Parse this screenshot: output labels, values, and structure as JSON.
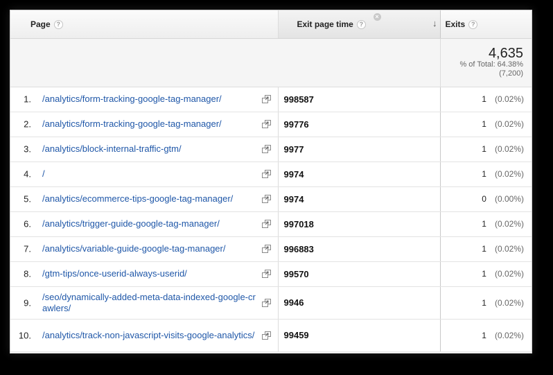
{
  "header": {
    "page_label": "Page",
    "time_label": "Exit page time",
    "exits_label": "Exits",
    "help_glyph": "?",
    "close_glyph": "×",
    "sort_glyph": "↓"
  },
  "summary": {
    "exits_total": "4,635",
    "exits_pct": "% of Total: 64.38%",
    "exits_site_total": "(7,200)"
  },
  "rows": [
    {
      "index": "1.",
      "page": "/analytics/form-tracking-google-tag-manager/",
      "time": "998587",
      "exits": "1",
      "pct": "(0.02%)"
    },
    {
      "index": "2.",
      "page": "/analytics/form-tracking-google-tag-manager/",
      "time": "99776",
      "exits": "1",
      "pct": "(0.02%)"
    },
    {
      "index": "3.",
      "page": "/analytics/block-internal-traffic-gtm/",
      "time": "9977",
      "exits": "1",
      "pct": "(0.02%)"
    },
    {
      "index": "4.",
      "page": "/",
      "time": "9974",
      "exits": "1",
      "pct": "(0.02%)"
    },
    {
      "index": "5.",
      "page": "/analytics/ecommerce-tips-google-tag-manager/",
      "time": "9974",
      "exits": "0",
      "pct": "(0.00%)"
    },
    {
      "index": "6.",
      "page": "/analytics/trigger-guide-google-tag-manager/",
      "time": "997018",
      "exits": "1",
      "pct": "(0.02%)"
    },
    {
      "index": "7.",
      "page": "/analytics/variable-guide-google-tag-manager/",
      "time": "996883",
      "exits": "1",
      "pct": "(0.02%)"
    },
    {
      "index": "8.",
      "page": "/gtm-tips/once-userid-always-userid/",
      "time": "99570",
      "exits": "1",
      "pct": "(0.02%)"
    },
    {
      "index": "9.",
      "page": "/seo/dynamically-added-meta-data-indexed-google-crawlers/",
      "time": "9946",
      "exits": "1",
      "pct": "(0.02%)"
    },
    {
      "index": "10.",
      "page": "/analytics/track-non-javascript-visits-google-analytics/",
      "time": "99459",
      "exits": "1",
      "pct": "(0.02%)"
    }
  ],
  "icons": {
    "help": "help-circle-icon",
    "close": "close-icon",
    "sort": "sort-descending-icon",
    "row_link": "open-external-icon"
  },
  "colors": {
    "link": "#1f57a8",
    "background": "#000000"
  }
}
